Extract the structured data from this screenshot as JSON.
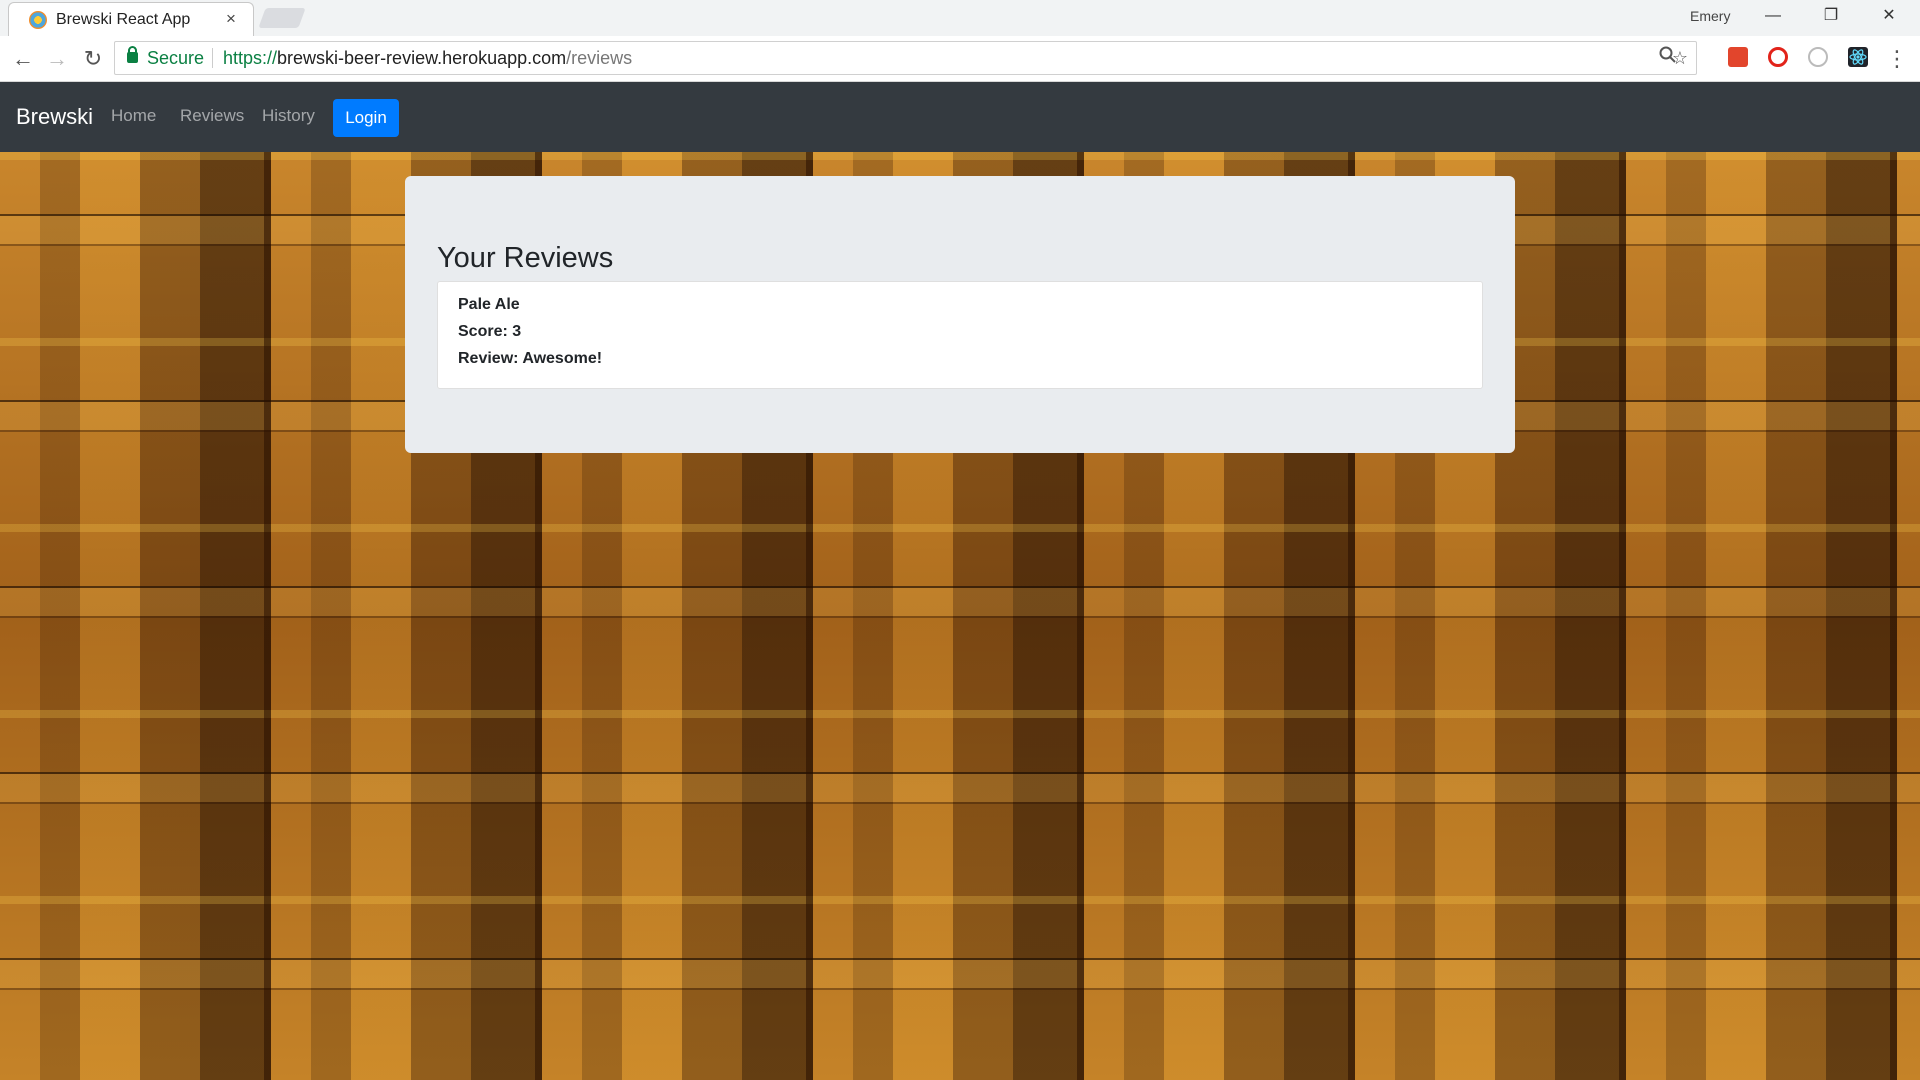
{
  "browser": {
    "tab_title": "Brewski React App",
    "tab_close": "×",
    "user_name": "Emery",
    "window_controls": {
      "minimize": "—",
      "restore": "❐",
      "close": "✕"
    },
    "nav": {
      "back": "←",
      "forward": "→",
      "reload": "↻"
    },
    "security_label": "Secure",
    "url": {
      "scheme": "https://",
      "host": "brewski-beer-review.herokuapp.com",
      "path": "/reviews"
    },
    "icons": [
      "zoom-icon",
      "bookmark-star-icon",
      "extension-icon",
      "opera-icon",
      "extension-circle-icon",
      "react-devtools-icon",
      "menu-icon"
    ]
  },
  "navbar": {
    "brand": "Brewski",
    "links": [
      "Home",
      "Reviews",
      "History"
    ],
    "login_label": "Login"
  },
  "main": {
    "title": "Your Reviews",
    "reviews": [
      {
        "beer": "Pale Ale",
        "score_line": "Score: 3",
        "review_line": "Review: Awesome!"
      }
    ]
  },
  "colors": {
    "navbar_bg": "#343a40",
    "login_button": "#007bff",
    "jumbotron_bg": "#e9ecef",
    "secure_green": "#0b8043"
  }
}
